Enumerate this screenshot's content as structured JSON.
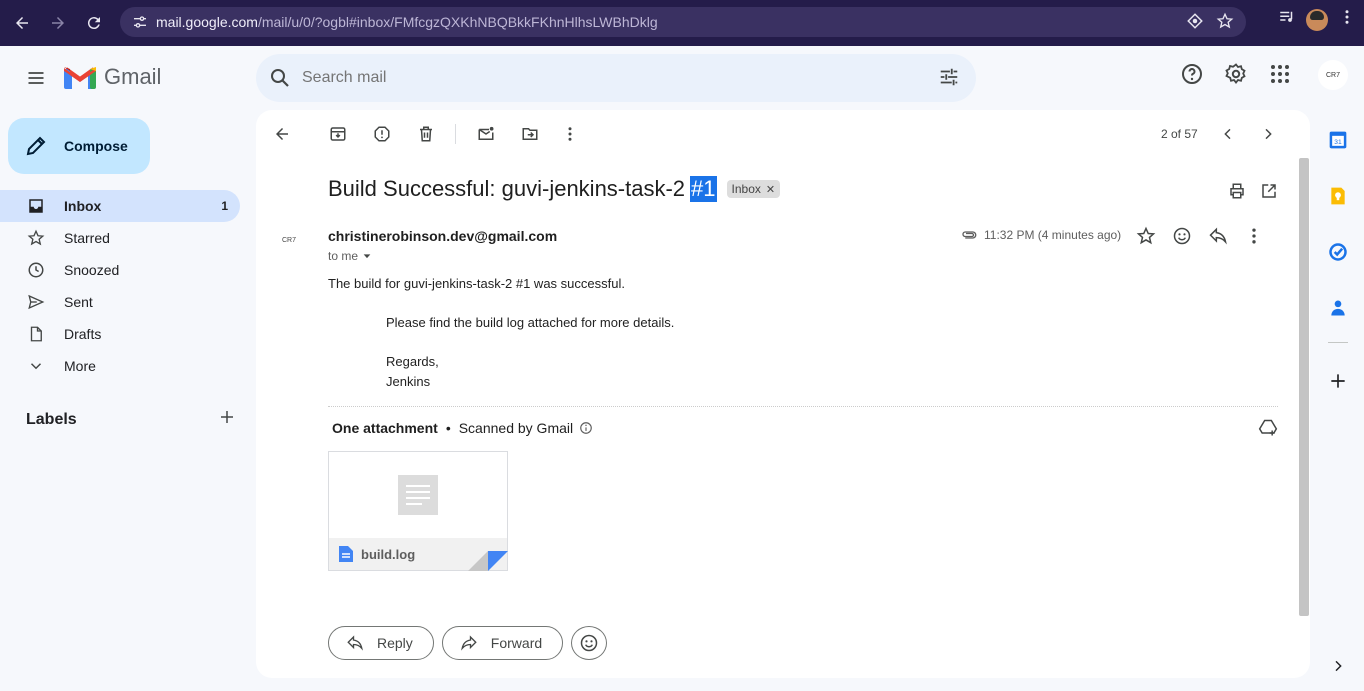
{
  "browser": {
    "url_host": "mail.google.com",
    "url_path": "/mail/u/0/?ogbl#inbox/FMfcgzQXKhNBQBkkFKhnHlhsLWBhDklg"
  },
  "header": {
    "logo_text": "Gmail",
    "search_placeholder": "Search mail",
    "account_initials": "CR7"
  },
  "sidebar": {
    "compose_label": "Compose",
    "items": [
      {
        "label": "Inbox",
        "count": "1",
        "icon": "inbox-icon"
      },
      {
        "label": "Starred",
        "count": "",
        "icon": "star-icon"
      },
      {
        "label": "Snoozed",
        "count": "",
        "icon": "clock-icon"
      },
      {
        "label": "Sent",
        "count": "",
        "icon": "send-icon"
      },
      {
        "label": "Drafts",
        "count": "",
        "icon": "draft-icon"
      },
      {
        "label": "More",
        "count": "",
        "icon": "chevron-down-icon"
      }
    ],
    "labels_title": "Labels"
  },
  "toolbar": {
    "pager": "2 of 57"
  },
  "email": {
    "subject": "Build Successful: guvi-jenkins-task-2",
    "subject_highlight": "#1",
    "chip": "Inbox",
    "sender": "christinerobinson.dev@gmail.com",
    "sender_avatar": "CR7",
    "to": "to me",
    "time": "11:32 PM (4 minutes ago)",
    "body": {
      "line1": "The build for guvi-jenkins-task-2 #1 was successful.",
      "line2": "Please find the build log attached for more details.",
      "line3": "Regards,",
      "line4": "Jenkins"
    },
    "attachments": {
      "heading": "One attachment",
      "scanned": "Scanned by Gmail",
      "file_name": "build.log"
    },
    "actions": {
      "reply": "Reply",
      "forward": "Forward"
    }
  },
  "colors": {
    "accent": "#1a73e8",
    "compose_bg": "#c2e7ff",
    "active_nav": "#d3e3fd",
    "chrome_bg": "#241c4a"
  }
}
